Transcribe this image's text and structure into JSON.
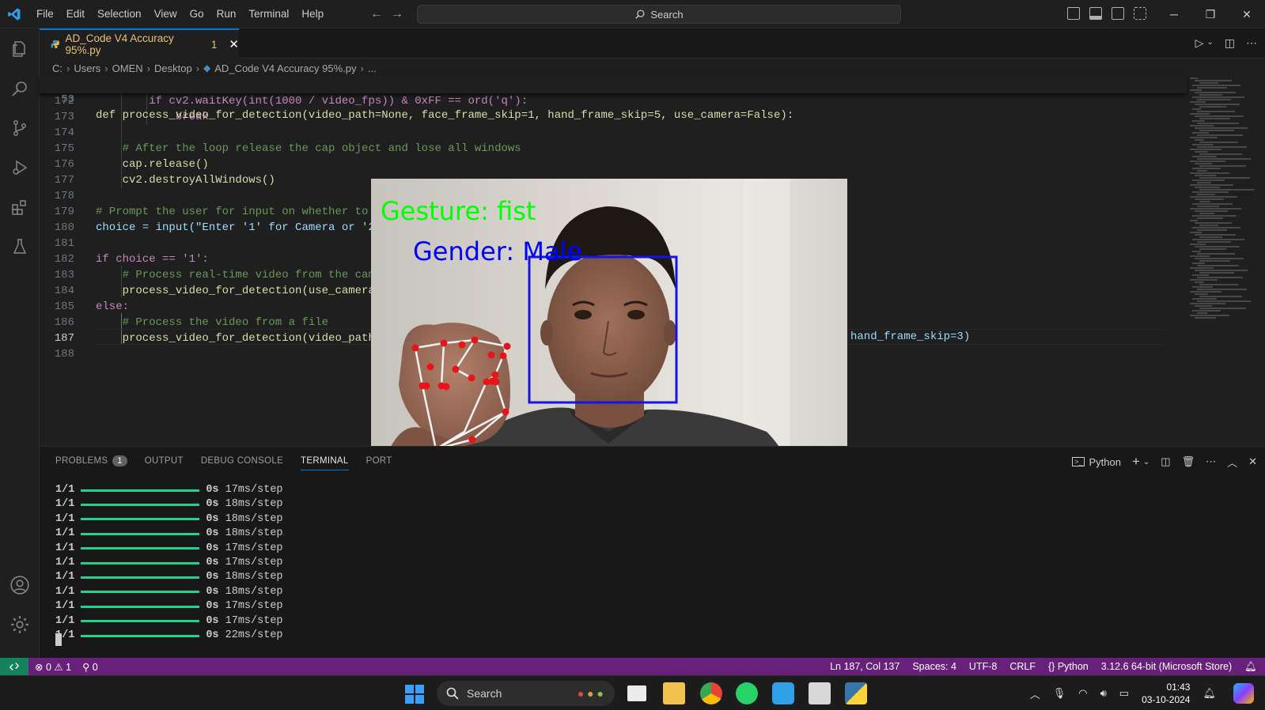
{
  "titlebar": {
    "menu": [
      "File",
      "Edit",
      "Selection",
      "View",
      "Go",
      "Run",
      "Terminal",
      "Help"
    ],
    "search_placeholder": "Search",
    "logo_icon": "vscode-logo-icon",
    "accent": "#0078d4"
  },
  "tab": {
    "filename": "AD_Code V4 Accuracy 95%.py",
    "problem_count": "1"
  },
  "breadcrumb": {
    "parts": [
      "C:",
      "Users",
      "OMEN",
      "Desktop",
      "AD_Code V4 Accuracy 95%.py",
      "..."
    ]
  },
  "editor": {
    "sticky": {
      "line": "53",
      "code": "def process_video_for_detection(video_path=None, face_frame_skip=1, hand_frame_skip=5, use_camera=False):"
    },
    "lines": [
      {
        "n": "172",
        "code": "        if cv2.waitKey(int(1000 / video_fps)) & 0xFF == ord('q'):"
      },
      {
        "n": "173",
        "code": "            break"
      },
      {
        "n": "174",
        "code": ""
      },
      {
        "n": "175",
        "code": "    # After the loop release the cap object and lose all windows"
      },
      {
        "n": "176",
        "code": "    cap.release()"
      },
      {
        "n": "177",
        "code": "    cv2.destroyAllWindows()"
      },
      {
        "n": "178",
        "code": ""
      },
      {
        "n": "179",
        "code": "# Prompt the user for input on whether to u"
      },
      {
        "n": "180",
        "code": "choice = input(\"Enter '1' for Camera or '2'"
      },
      {
        "n": "181",
        "code": ""
      },
      {
        "n": "182",
        "code": "if choice == '1':"
      },
      {
        "n": "183",
        "code": "    # Process real-time video from the came"
      },
      {
        "n": "184",
        "code": "    process_video_for_detection(use_camera="
      },
      {
        "n": "185",
        "code": "else:"
      },
      {
        "n": "186",
        "code": "    # Process the video from a file"
      },
      {
        "n": "187",
        "code": "    process_video_for_detection(video_path="
      },
      {
        "n": "188",
        "code": ""
      }
    ],
    "line187_tail": "hand_frame_skip=3)"
  },
  "panel": {
    "tabs": [
      "PROBLEMS",
      "OUTPUT",
      "DEBUG CONSOLE",
      "TERMINAL",
      "PORT"
    ],
    "active_tab": "TERMINAL",
    "problems_badge": "1",
    "shell": "Python",
    "terminal_lines": [
      {
        "step": "1/1",
        "time": "0s",
        "rate": "17ms/step"
      },
      {
        "step": "1/1",
        "time": "0s",
        "rate": "18ms/step"
      },
      {
        "step": "1/1",
        "time": "0s",
        "rate": "18ms/step"
      },
      {
        "step": "1/1",
        "time": "0s",
        "rate": "18ms/step"
      },
      {
        "step": "1/1",
        "time": "0s",
        "rate": "17ms/step"
      },
      {
        "step": "1/1",
        "time": "0s",
        "rate": "17ms/step"
      },
      {
        "step": "1/1",
        "time": "0s",
        "rate": "18ms/step"
      },
      {
        "step": "1/1",
        "time": "0s",
        "rate": "18ms/step"
      },
      {
        "step": "1/1",
        "time": "0s",
        "rate": "17ms/step"
      },
      {
        "step": "1/1",
        "time": "0s",
        "rate": "17ms/step"
      },
      {
        "step": "1/1",
        "time": "0s",
        "rate": "22ms/step"
      }
    ]
  },
  "camera": {
    "gesture_text": "Gesture: fist",
    "gender_text": "Gender: Male",
    "gesture_color": "#00ff00",
    "gender_color": "#0000ff",
    "landmark_color": "#e8141a"
  },
  "statusbar": {
    "errors": "0",
    "warnings": "1",
    "ports": "0",
    "position": "Ln 187, Col 137",
    "spaces": "Spaces: 4",
    "encoding": "UTF-8",
    "eol": "CRLF",
    "language": "Python",
    "interpreter": "3.12.6 64-bit (Microsoft Store)",
    "background": "#68217a"
  },
  "taskbar": {
    "search_label": "Search",
    "time": "01:43",
    "date": "03-10-2024"
  }
}
